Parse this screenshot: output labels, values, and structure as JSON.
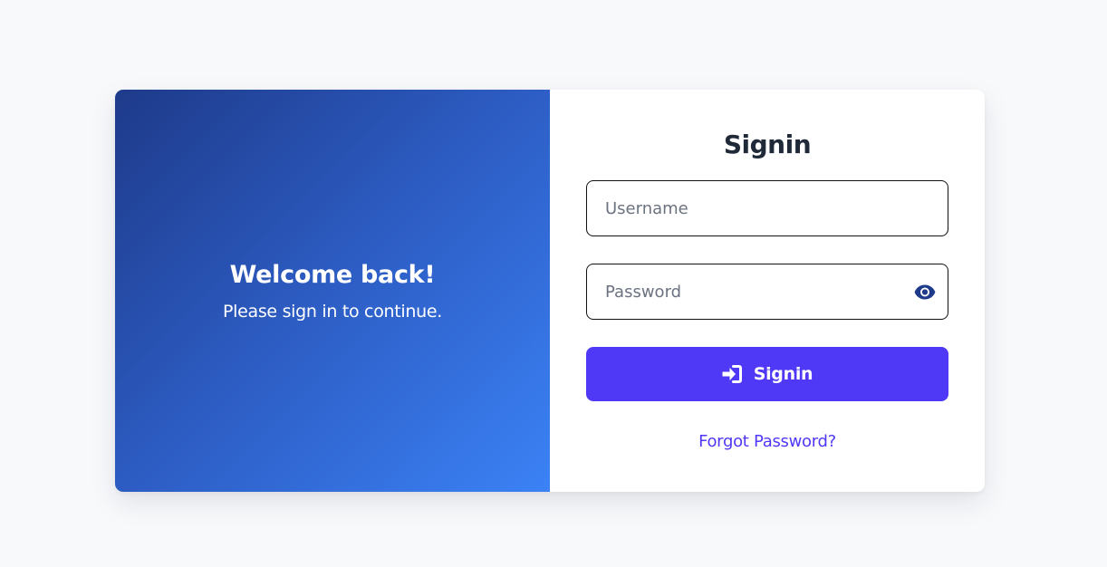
{
  "welcome": {
    "title": "Welcome back!",
    "subtitle": "Please sign in to continue."
  },
  "form": {
    "title": "Signin",
    "username": {
      "placeholder": "Username",
      "value": ""
    },
    "password": {
      "placeholder": "Password",
      "value": "",
      "toggle_icon": "eye-icon"
    },
    "submit": {
      "label": "Signin",
      "icon": "sign-in-icon"
    },
    "forgot_label": "Forgot Password?"
  },
  "colors": {
    "background": "#f8f9fb",
    "gradient_start": "#1e3a8a",
    "gradient_end": "#3b82f6",
    "accent": "#4f39f6",
    "title_text": "#1f2937",
    "eye_icon": "#1e3a8a"
  }
}
